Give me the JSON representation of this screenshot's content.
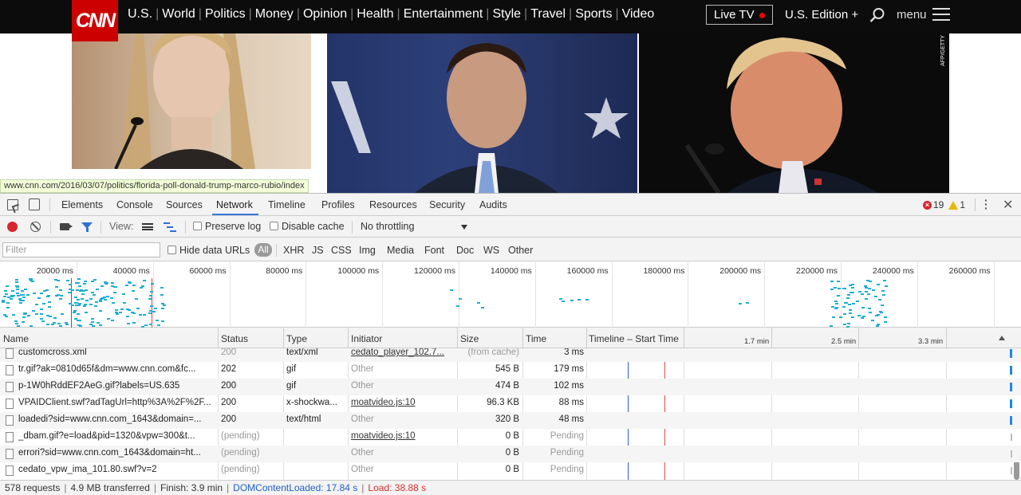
{
  "cnn": {
    "logo": "CNN",
    "nav": [
      "U.S.",
      "World",
      "Politics",
      "Money",
      "Opinion",
      "Health",
      "Entertainment",
      "Style",
      "Travel",
      "Sports",
      "Video"
    ],
    "live_tv": "Live TV",
    "edition": "U.S. Edition +",
    "menu": "menu",
    "photo_credit": "AFP/GETTY"
  },
  "status_url": "www.cnn.com/2016/03/07/politics/florida-poll-donald-trump-marco-rubio/index",
  "devtools": {
    "tabs": [
      "Elements",
      "Console",
      "Sources",
      "Network",
      "Timeline",
      "Profiles",
      "Resources",
      "Security",
      "Audits"
    ],
    "active_tab": "Network",
    "errors": "19",
    "warnings": "1",
    "toolbar": {
      "view_label": "View:",
      "preserve_log": "Preserve log",
      "disable_cache": "Disable cache",
      "throttling": "No throttling"
    },
    "filter": {
      "placeholder": "Filter",
      "hide_data_urls": "Hide data URLs",
      "all": "All",
      "types": [
        "XHR",
        "JS",
        "CSS",
        "Img",
        "Media",
        "Font",
        "Doc",
        "WS",
        "Other"
      ]
    },
    "overview_ticks": [
      "20000 ms",
      "40000 ms",
      "60000 ms",
      "80000 ms",
      "100000 ms",
      "120000 ms",
      "140000 ms",
      "160000 ms",
      "180000 ms",
      "200000 ms",
      "220000 ms",
      "240000 ms",
      "260000 ms"
    ],
    "columns": [
      "Name",
      "Status",
      "Type",
      "Initiator",
      "Size",
      "Time",
      "Timeline – Start Time"
    ],
    "timeline_ticks": [
      "1.7 min",
      "2.5 min",
      "3.3 min"
    ],
    "rows": [
      {
        "name": "customcross.xml",
        "status": "200",
        "type": "text/xml",
        "initiator": "cedato_player_102.7...",
        "size": "(from cache)",
        "time": "3 ms",
        "status_muted": true,
        "initiator_link": true
      },
      {
        "name": "tr.gif?ak=0810d65f&dm=www.cnn.com&fc...",
        "status": "202",
        "type": "gif",
        "initiator": "Other",
        "size": "545 B",
        "time": "179 ms",
        "status_muted": false,
        "initiator_link": false
      },
      {
        "name": "p-1W0hRddEF2AeG.gif?labels=US.635",
        "status": "200",
        "type": "gif",
        "initiator": "Other",
        "size": "474 B",
        "time": "102 ms",
        "status_muted": false,
        "initiator_link": false
      },
      {
        "name": "VPAIDClient.swf?adTagUrl=http%3A%2F%2F...",
        "status": "200",
        "type": "x-shockwa...",
        "initiator": "moatvideo.js:10",
        "size": "96.3 KB",
        "time": "88 ms",
        "status_muted": false,
        "initiator_link": true
      },
      {
        "name": "loadedi?sid=www.cnn.com_1643&domain=...",
        "status": "200",
        "type": "text/html",
        "initiator": "Other",
        "size": "320 B",
        "time": "48 ms",
        "status_muted": false,
        "initiator_link": false
      },
      {
        "name": "_dbam.gif?e=load&pid=1320&vpw=300&t...",
        "status": "(pending)",
        "type": "",
        "initiator": "moatvideo.js:10",
        "size": "0 B",
        "time": "Pending",
        "status_muted": true,
        "initiator_link": true
      },
      {
        "name": "errori?sid=www.cnn.com_1643&domain=ht...",
        "status": "(pending)",
        "type": "",
        "initiator": "Other",
        "size": "0 B",
        "time": "Pending",
        "status_muted": true,
        "initiator_link": false
      },
      {
        "name": "cedato_vpw_ima_101.80.swf?v=2",
        "status": "(pending)",
        "type": "",
        "initiator": "Other",
        "size": "0 B",
        "time": "Pending",
        "status_muted": true,
        "initiator_link": false
      }
    ],
    "summary": {
      "requests": "578 requests",
      "transferred": "4.9 MB transferred",
      "finish": "Finish: 3.9 min",
      "dom_loaded": "DOMContentLoaded: 17.84 s",
      "load": "Load: 38.88 s"
    },
    "colors": {
      "accent": "#3879d9",
      "record": "#d8262e",
      "bar": "#1eaed0"
    }
  }
}
